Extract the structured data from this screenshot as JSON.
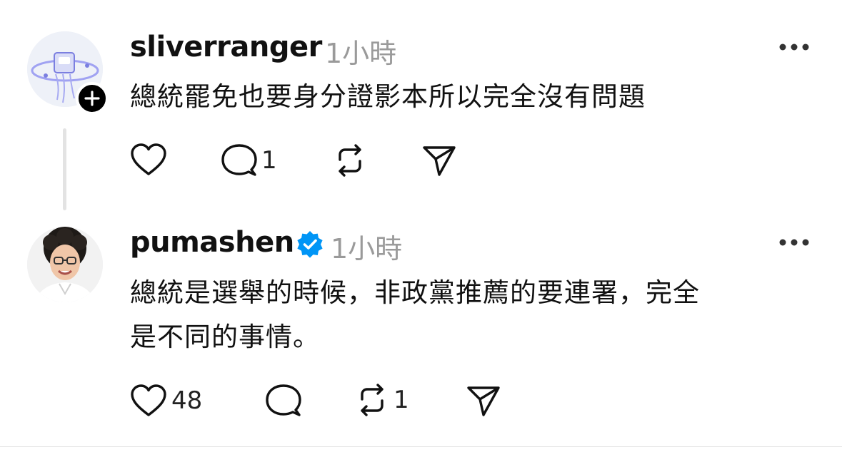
{
  "posts": [
    {
      "username": "sliverranger",
      "time": "1小時",
      "text": "總統罷免也要身分證影本所以完全沒有問題",
      "reply_count": "1",
      "like_count": "",
      "repost_count": ""
    },
    {
      "username": "pumashen",
      "time": "1小時",
      "text_line1": "總統是選舉的時候，非政黨推薦的要連署，完全",
      "text_line2": "是不同的事情。",
      "like_count": "48",
      "reply_count": "",
      "repost_count": "1"
    }
  ],
  "colors": {
    "verified": "#0095f6",
    "muted": "#9a9a9a",
    "thread_line": "#e3e3e3"
  },
  "icons": [
    "plus-icon",
    "heart-icon",
    "comment-icon",
    "repost-icon",
    "share-icon",
    "more-icon",
    "verified-icon"
  ]
}
